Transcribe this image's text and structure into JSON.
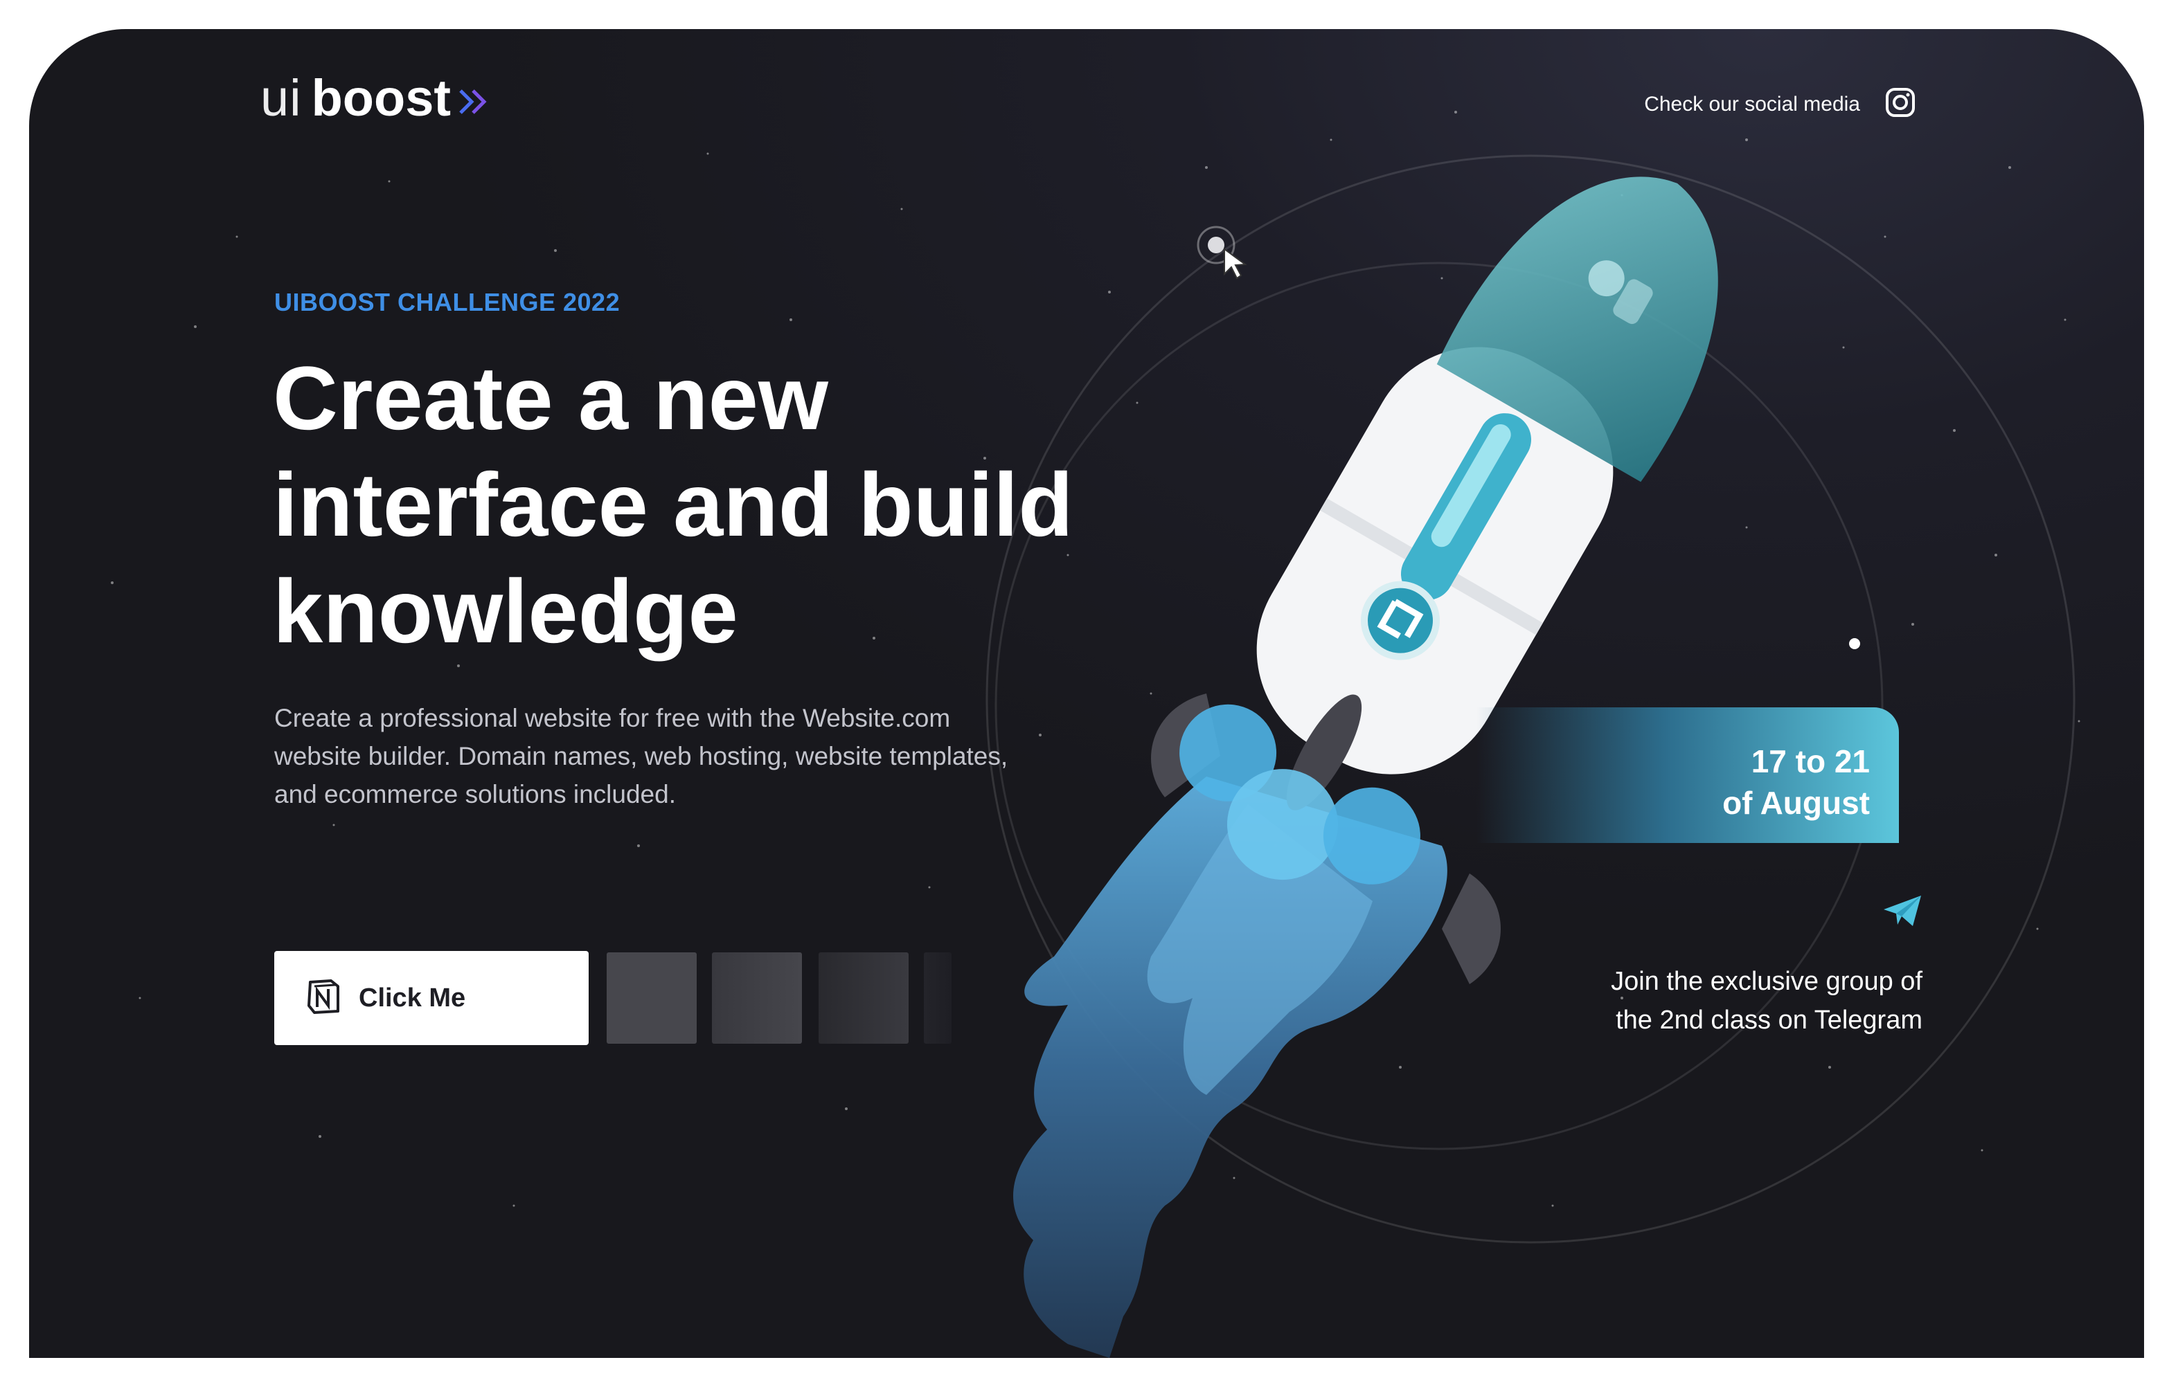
{
  "header": {
    "logo": {
      "light": "ui",
      "bold": "boost",
      "icon": "double-chevron-right-icon"
    },
    "social_label": "Check our social media",
    "social_icon": "instagram-icon"
  },
  "hero": {
    "kicker": "UIBOOST CHALLENGE 2022",
    "headline": [
      "Create a new",
      "interface and build",
      "knowledge"
    ],
    "description": [
      "Create a professional website for free with the Website.com",
      "website builder. Domain names, web hosting, website templates,",
      "and ecommerce solutions included."
    ],
    "cta": {
      "label": "Click Me",
      "icon": "notion-icon"
    }
  },
  "event": {
    "dates": [
      "17 to 21",
      "of August"
    ]
  },
  "telegram": {
    "icon": "telegram-plane-icon",
    "text": [
      "Join the exclusive group of",
      "the 2nd class on Telegram"
    ]
  },
  "colors": {
    "background": "#1e1e28",
    "accent_blue": "#3f8fe6",
    "accent_teal": "#5cc6dc",
    "cta_background": "#ffffff",
    "text_primary": "#ffffff",
    "text_secondary": "#c3c4cc"
  }
}
